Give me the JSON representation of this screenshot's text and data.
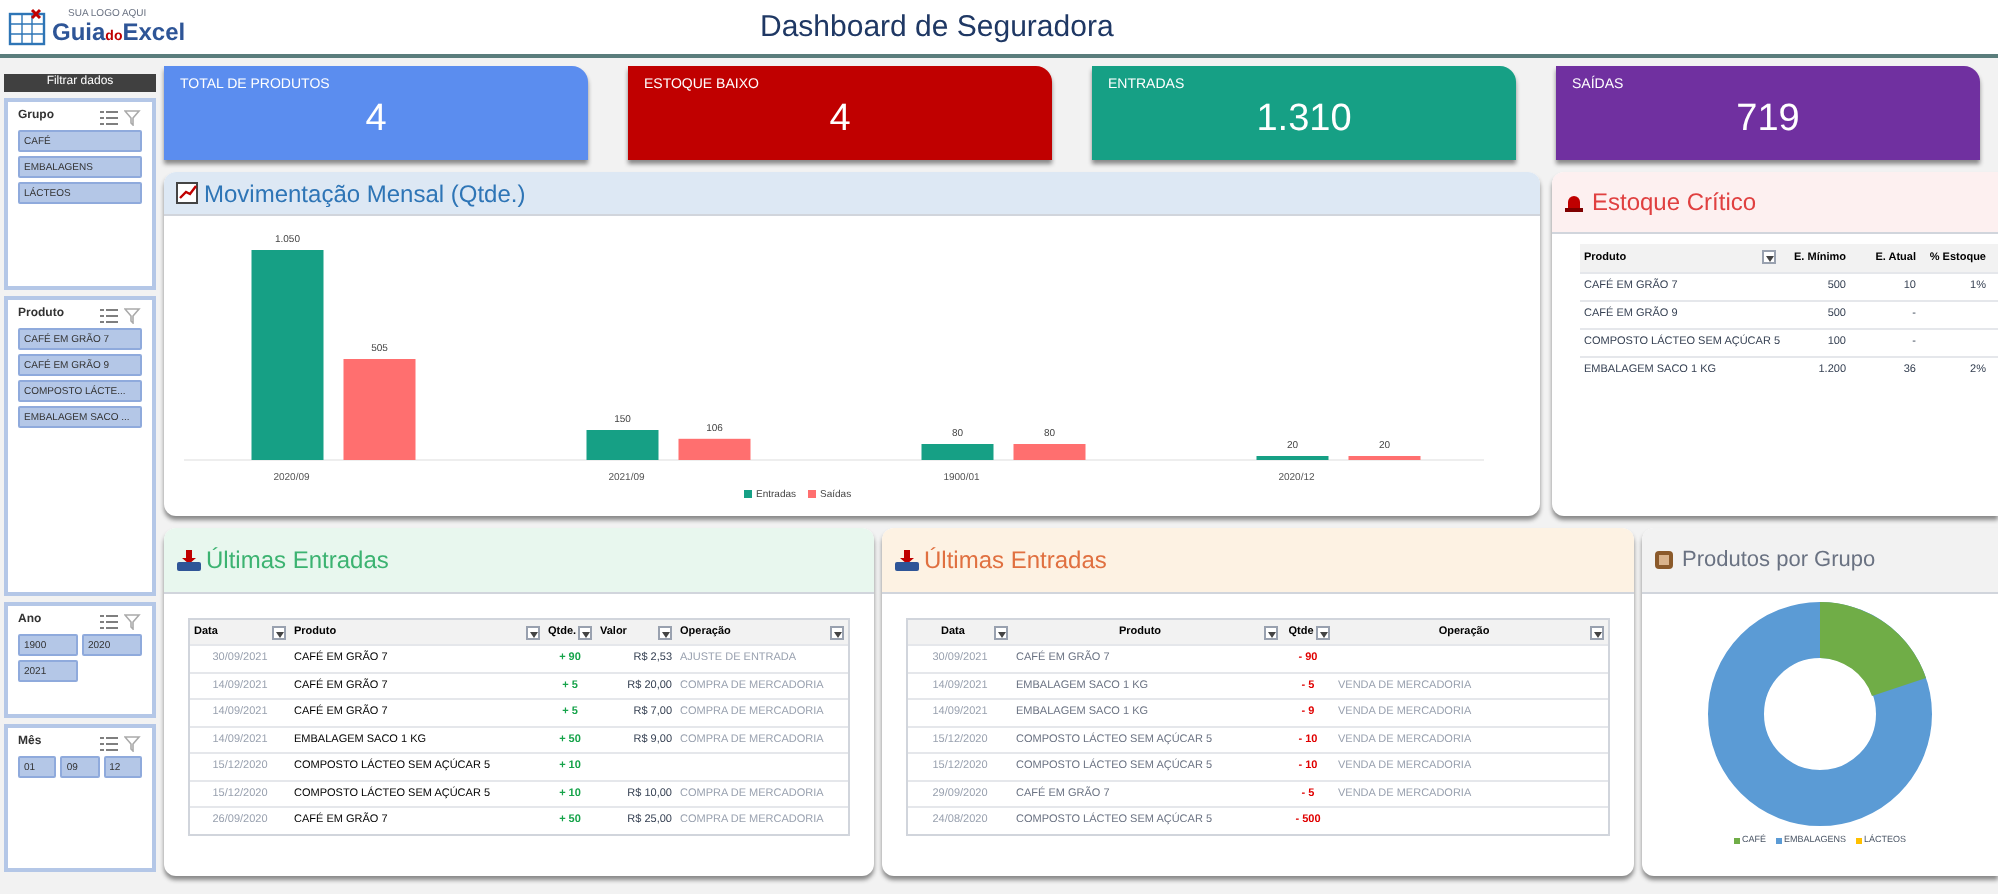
{
  "header": {
    "logo_tagline": "SUA LOGO AQUI",
    "logo_a": "Guia",
    "logo_b": "do",
    "logo_c": "Excel",
    "title": "Dashboard de Seguradora"
  },
  "sidebar": {
    "title": "Filtrar dados",
    "slicers": [
      {
        "title": "Grupo",
        "items": [
          {
            "label": "CAFÉ",
            "selected": true
          },
          {
            "label": "EMBALAGENS",
            "selected": true
          },
          {
            "label": "LÁCTEOS",
            "selected": true
          }
        ]
      },
      {
        "title": "Produto",
        "items": [
          {
            "label": "CAFÉ EM GRÃO 7",
            "selected": true
          },
          {
            "label": "CAFÉ EM GRÃO 9",
            "selected": true
          },
          {
            "label": "COMPOSTO LÁCTE...",
            "selected": true
          },
          {
            "label": "EMBALAGEM SACO ...",
            "selected": true
          }
        ]
      },
      {
        "title": "Ano",
        "items": [
          {
            "label": "1900",
            "selected": true
          },
          {
            "label": "2020",
            "selected": true
          },
          {
            "label": "2021",
            "selected": true
          }
        ]
      },
      {
        "title": "Mês",
        "items": [
          {
            "label": "01",
            "selected": true
          },
          {
            "label": "09",
            "selected": true
          },
          {
            "label": "12",
            "selected": true
          }
        ]
      }
    ]
  },
  "kpis": [
    {
      "label": "TOTAL DE PRODUTOS",
      "value": "4",
      "color": "#5b8def"
    },
    {
      "label": "ESTOQUE BAIXO",
      "value": "4",
      "color": "#c00000"
    },
    {
      "label": "ENTRADAS",
      "value": "1.310",
      "color": "#16a085"
    },
    {
      "label": "SAÍDAS",
      "value": "719",
      "color": "#7030a0"
    }
  ],
  "monthly": {
    "title": "Movimentação Mensal (Qtde.)",
    "chart_data": {
      "type": "bar",
      "categories": [
        "2020/09",
        "2021/09",
        "1900/01",
        "2020/12"
      ],
      "series": [
        {
          "name": "Entradas",
          "color": "#16a085",
          "values": [
            1050,
            150,
            80,
            20
          ],
          "value_labels": [
            "1.050",
            "150",
            "80",
            "20"
          ]
        },
        {
          "name": "Saídas",
          "color": "#ff6f6f",
          "values": [
            505,
            106,
            80,
            20
          ],
          "value_labels": [
            "505",
            "106",
            "80",
            "20"
          ]
        }
      ],
      "legend": "bottom"
    }
  },
  "critical": {
    "title": "Estoque Crítico",
    "columns": [
      "Produto",
      "E. Mínimo",
      "E. Atual",
      "% Estoque"
    ],
    "rows": [
      [
        "CAFÉ EM GRÃO 7",
        "500",
        "10",
        "1%"
      ],
      [
        "CAFÉ EM GRÃO 9",
        "500",
        "-",
        ""
      ],
      [
        "COMPOSTO LÁCTEO SEM AÇÚCAR 5",
        "100",
        "-",
        ""
      ],
      [
        "EMBALAGEM SACO 1 KG",
        "1.200",
        "36",
        "2%"
      ]
    ]
  },
  "tables": [
    {
      "kind": "in",
      "title": "Últimas Entradas",
      "columns": [
        "Data",
        "Produto",
        "Qtde.",
        "Valor",
        "Operação"
      ],
      "rows": [
        [
          "30/09/2021",
          "CAFÉ EM GRÃO 7",
          "+ 90",
          "R$ 2,53",
          "AJUSTE DE ENTRADA"
        ],
        [
          "14/09/2021",
          "CAFÉ EM GRÃO 7",
          "+ 5",
          "R$ 20,00",
          "COMPRA DE MERCADORIA"
        ],
        [
          "14/09/2021",
          "CAFÉ EM GRÃO 7",
          "+ 5",
          "R$ 7,00",
          "COMPRA DE MERCADORIA"
        ],
        [
          "14/09/2021",
          "EMBALAGEM SACO 1 KG",
          "+ 50",
          "R$ 9,00",
          "COMPRA DE MERCADORIA"
        ],
        [
          "15/12/2020",
          "COMPOSTO LÁCTEO SEM AÇÚCAR 5",
          "+ 10",
          "",
          ""
        ],
        [
          "15/12/2020",
          "COMPOSTO LÁCTEO SEM AÇÚCAR 5",
          "+ 10",
          "R$ 10,00",
          "COMPRA DE MERCADORIA"
        ],
        [
          "26/09/2020",
          "CAFÉ EM GRÃO 7",
          "+ 50",
          "R$ 25,00",
          "COMPRA DE MERCADORIA"
        ]
      ]
    },
    {
      "kind": "out",
      "title": "Últimas Entradas",
      "columns": [
        "Data",
        "Produto",
        "Qtde",
        "Operação"
      ],
      "rows": [
        [
          "30/09/2021",
          "CAFÉ EM GRÃO 7",
          "- 90",
          ""
        ],
        [
          "14/09/2021",
          "EMBALAGEM SACO 1 KG",
          "- 5",
          "VENDA DE MERCADORIA"
        ],
        [
          "14/09/2021",
          "EMBALAGEM SACO 1 KG",
          "- 9",
          "VENDA DE MERCADORIA"
        ],
        [
          "15/12/2020",
          "COMPOSTO LÁCTEO SEM AÇÚCAR 5",
          "- 10",
          "VENDA DE MERCADORIA"
        ],
        [
          "15/12/2020",
          "COMPOSTO LÁCTEO SEM AÇÚCAR 5",
          "- 10",
          "VENDA DE MERCADORIA"
        ],
        [
          "29/09/2020",
          "CAFÉ EM GRÃO 7",
          "- 5",
          "VENDA DE MERCADORIA"
        ],
        [
          "24/08/2020",
          "COMPOSTO LÁCTEO SEM AÇÚCAR 5",
          "- 500",
          ""
        ]
      ]
    }
  ],
  "groups": {
    "title": "Produtos por Grupo",
    "legend": [
      {
        "label": "CAFÉ",
        "color": "#70ad47"
      },
      {
        "label": "EMBALAGENS",
        "color": "#5b9bd5"
      },
      {
        "label": "LÁCTEOS",
        "color": "#ffc000"
      }
    ]
  }
}
